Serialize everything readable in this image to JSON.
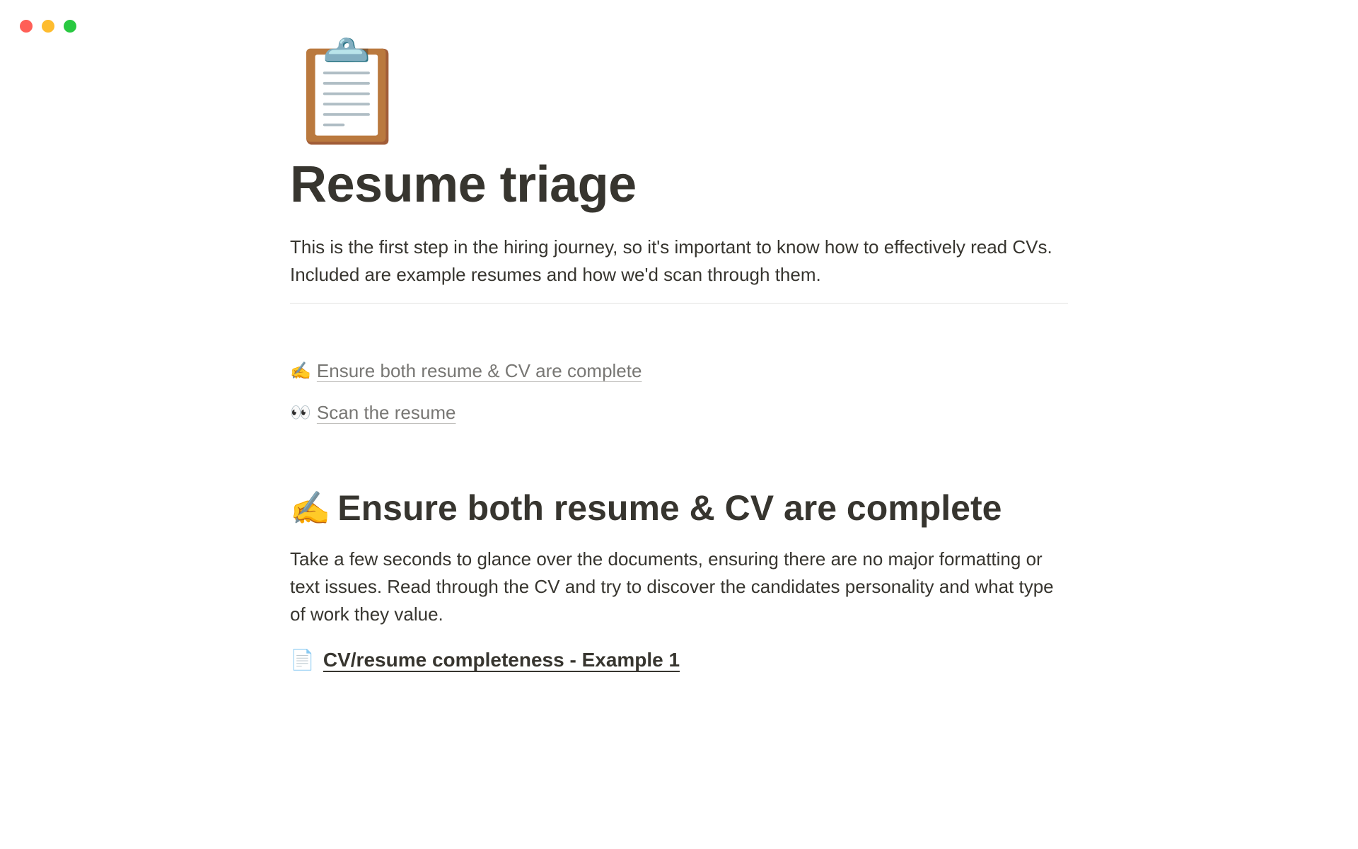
{
  "page_icon": "📋",
  "title": "Resume triage",
  "intro": "This is the first step in the hiring journey, so it's important to know how to effectively read CVs. Included are example resumes and how we'd scan through them.",
  "toc": [
    {
      "emoji": "✍️",
      "label": "Ensure both resume & CV are complete"
    },
    {
      "emoji": "👀",
      "label": "Scan the resume"
    }
  ],
  "section1": {
    "emoji": "✍️",
    "heading": "Ensure both resume & CV are complete",
    "body": "Take a few seconds to glance over the documents, ensuring there are no major formatting or text issues. Read through the CV and try to discover the candidates personality and what type of work they value.",
    "example_emoji": "📄",
    "example_label": "CV/resume completeness - Example 1"
  }
}
